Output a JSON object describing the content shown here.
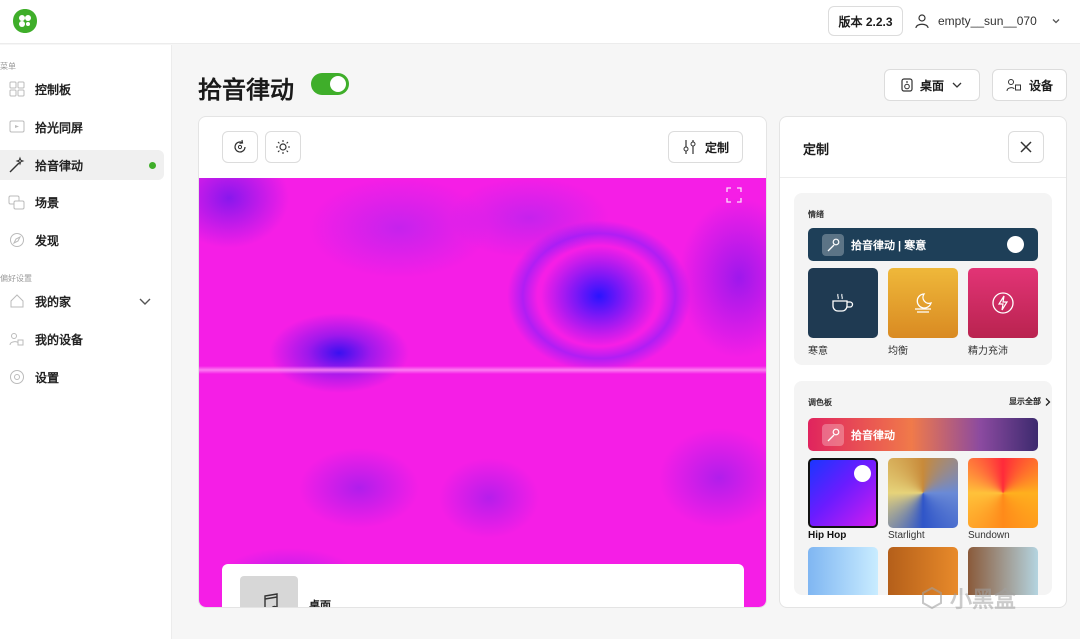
{
  "app": {
    "version_label": "版本 2.2.3",
    "username": "empty__sun__070",
    "accent_color": "#3fae2a"
  },
  "sidebar": {
    "menu_label": "菜单",
    "items": [
      {
        "label": "控制板",
        "icon": "dashboard-icon"
      },
      {
        "label": "拾光同屏",
        "icon": "screen-sync-icon"
      },
      {
        "label": "拾音律动",
        "icon": "wand-icon",
        "active": true
      },
      {
        "label": "场景",
        "icon": "scene-icon"
      },
      {
        "label": "发现",
        "icon": "discover-icon"
      }
    ],
    "prefs_label": "偏好设置",
    "pref_items": [
      {
        "label": "我的家",
        "icon": "home-icon"
      },
      {
        "label": "我的设备",
        "icon": "devices-icon"
      },
      {
        "label": "设置",
        "icon": "gear-icon"
      }
    ]
  },
  "header": {
    "title": "拾音律动",
    "toggle_on": true,
    "speaker_btn": "桌面",
    "devices_btn": "设备"
  },
  "main": {
    "customize_btn": "定制",
    "source_label": "桌面"
  },
  "customize_panel": {
    "title": "定制",
    "mood_section": "情绪",
    "mood_banner": "拾音律动 | 寒意",
    "moods": [
      {
        "label": "寒意",
        "icon": "cup-icon",
        "color": "#1f3a52"
      },
      {
        "label": "均衡",
        "icon": "moon-icon",
        "color": "#e3a32b"
      },
      {
        "label": "精力充沛",
        "icon": "bolt-icon",
        "color": "#d42a67"
      }
    ],
    "palette_section": "调色板",
    "show_all": "显示全部",
    "palette_banner": "拾音律动",
    "palettes": [
      {
        "label": "Hip Hop",
        "selected": true
      },
      {
        "label": "Starlight"
      },
      {
        "label": "Sundown"
      }
    ]
  },
  "watermark": "小黑盒"
}
